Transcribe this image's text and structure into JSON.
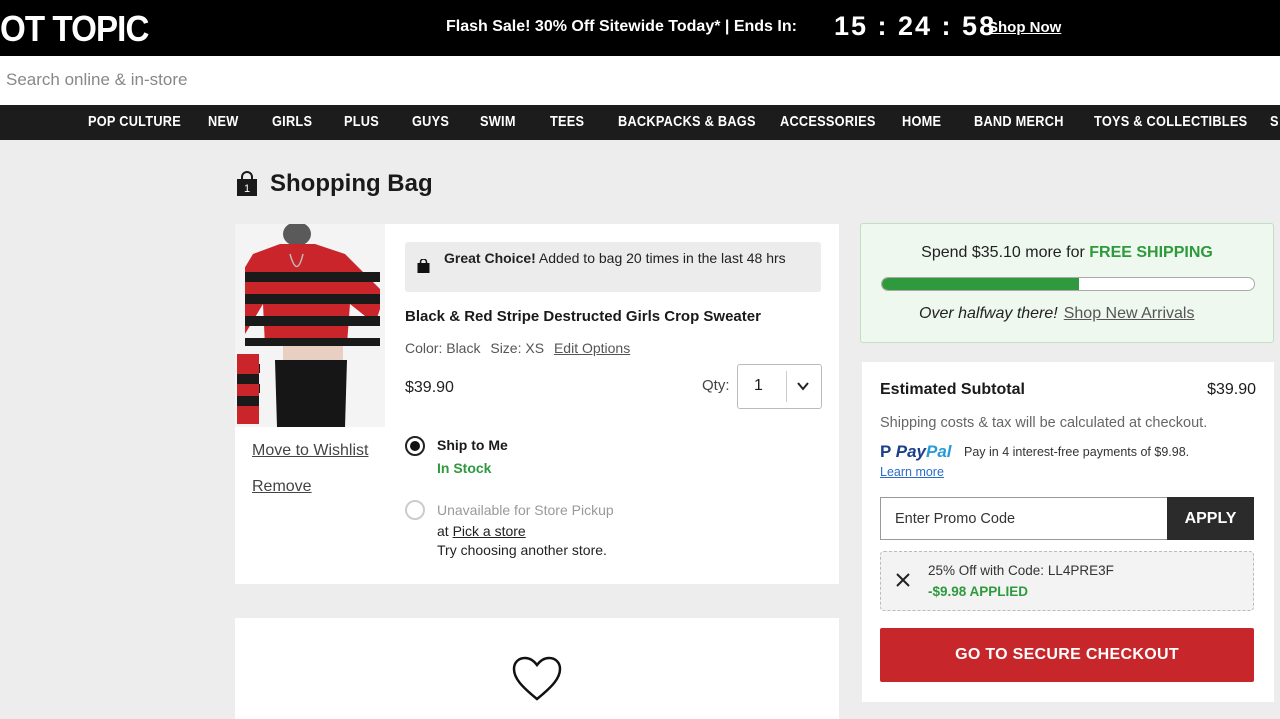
{
  "header": {
    "logo": "OT TOPIC",
    "promo_text": "Flash Sale! 30% Off Sitewide Today* | Ends In:",
    "timer": "15 : 24 : 58",
    "shop_now": "Shop Now"
  },
  "search": {
    "placeholder": "Search online & in-store"
  },
  "nav": {
    "items": [
      "POP CULTURE",
      "NEW",
      "GIRLS",
      "PLUS",
      "GUYS",
      "SWIM",
      "TEES",
      "BACKPACKS & BAGS",
      "ACCESSORIES",
      "HOME",
      "BAND MERCH",
      "TOYS & COLLECTIBLES",
      "S"
    ]
  },
  "page": {
    "title": "Shopping Bag"
  },
  "item": {
    "choice_bold": "Great Choice!",
    "choice_text": " Added to bag 20 times in the last 48 hrs",
    "name": "Black & Red Stripe Destructed Girls Crop Sweater",
    "color": "Color: Black",
    "size": "Size: XS",
    "edit": "Edit Options",
    "price": "$39.90",
    "qty_label": "Qty:",
    "qty_value": "1",
    "move_to_wishlist": "Move to Wishlist",
    "remove": "Remove",
    "ship_to_me": "Ship to Me",
    "in_stock": "In Stock",
    "pickup_unavailable": "Unavailable for Store Pickup",
    "pickup_at": "at ",
    "pick_a_store": "Pick a store",
    "try_another": "Try choosing another store."
  },
  "shipping": {
    "spend_prefix": "Spend $35.10 more for ",
    "free_shipping": "FREE SHIPPING",
    "progress_percent": 53,
    "halfway": "Over halfway there!",
    "shop_new": "Shop New Arrivals"
  },
  "summary": {
    "subtotal_label": "Estimated Subtotal",
    "subtotal_value": "$39.90",
    "shipping_note": "Shipping costs & tax will be calculated at checkout.",
    "paypal_logo_1": "Pay",
    "paypal_logo_2": "Pal",
    "paypal_text": "Pay in 4 interest-free payments of $9.98.",
    "learn_more": "Learn more",
    "promo_placeholder": "Enter Promo Code",
    "apply": "APPLY",
    "code_line": "25% Off with Code: LL4PRE3F",
    "code_applied": "-$9.98 APPLIED",
    "checkout": "GO TO SECURE CHECKOUT"
  },
  "colors": {
    "accent_red": "#c7262b",
    "success_green": "#2e9a3d",
    "nav_bg": "#1c1c1c"
  }
}
